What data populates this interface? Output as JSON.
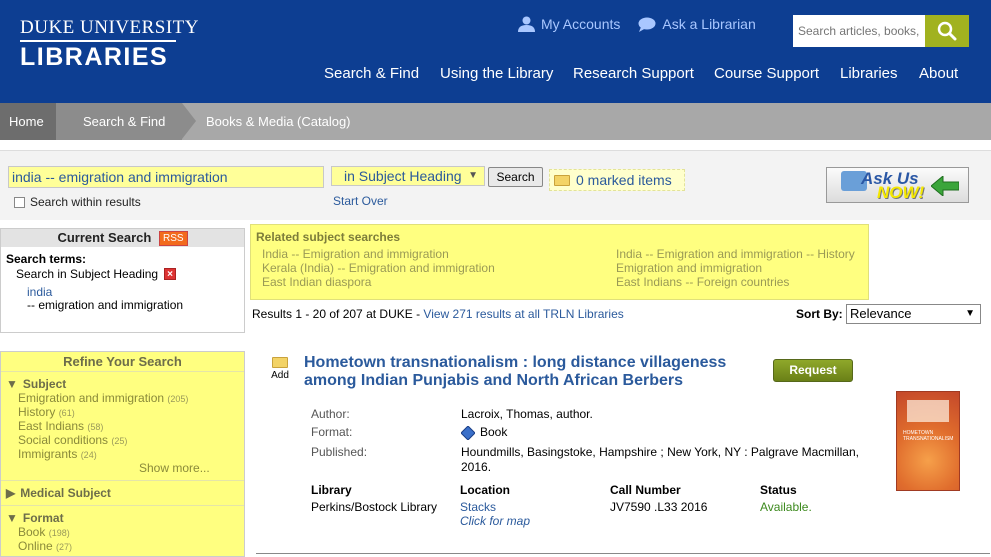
{
  "header": {
    "logo_line1": "DUKE UNIVERSITY",
    "logo_line2": "LIBRARIES",
    "my_accounts": "My Accounts",
    "ask_librarian": "Ask a Librarian",
    "search_placeholder": "Search articles, books,",
    "nav": [
      "Search & Find",
      "Using the Library",
      "Research Support",
      "Course Support",
      "Libraries",
      "About"
    ]
  },
  "breadcrumb": [
    "Home",
    "Search & Find",
    "Books & Media (Catalog)"
  ],
  "search": {
    "query": "india -- emigration and immigration",
    "scope": "in Subject Heading",
    "button": "Search",
    "marked": "0 marked items",
    "within": "Search within results",
    "start_over": "Start Over",
    "ask_us_1": "Ask Us",
    "ask_us_2": "NOW!"
  },
  "current_search": {
    "title": "Current Search",
    "rss": "RSS",
    "terms_label": "Search terms:",
    "heading": "Search in Subject Heading",
    "term1": "india",
    "term2": "--  emigration and immigration"
  },
  "refine": {
    "title": "Refine Your Search",
    "subject": "Subject",
    "subject_items": [
      {
        "label": "Emigration and immigration",
        "count": "(205)"
      },
      {
        "label": "History",
        "count": "(61)"
      },
      {
        "label": "East Indians",
        "count": "(58)"
      },
      {
        "label": "Social conditions",
        "count": "(25)"
      },
      {
        "label": "Immigrants",
        "count": "(24)"
      }
    ],
    "show_more": "Show more...",
    "medical_subject": "Medical Subject",
    "format": "Format",
    "format_items": [
      {
        "label": "Book",
        "count": "(198)"
      },
      {
        "label": "Online",
        "count": "(27)"
      }
    ]
  },
  "related": {
    "title": "Related subject searches",
    "links": [
      "India -- Emigration and immigration",
      "Kerala (India) -- Emigration and immigration",
      "East Indian diaspora",
      "India -- Emigration and immigration -- History",
      "Emigration and immigration",
      "East Indians -- Foreign countries"
    ]
  },
  "results": {
    "summary": "Results 1 - 20 of 207 at DUKE - ",
    "trln": "View 271 results at all TRLN Libraries",
    "sort_label": "Sort By:",
    "sort_value": "Relevance"
  },
  "item": {
    "add": "Add",
    "title": "Hometown transnationalism : long distance villageness among Indian Punjabis and North African Berbers",
    "request": "Request",
    "author_label": "Author:",
    "author": "Lacroix, Thomas, author.",
    "format_label": "Format:",
    "format": "Book",
    "published_label": "Published:",
    "published": "Houndmills, Basingstoke, Hampshire ; New York, NY : Palgrave Macmillan, 2016.",
    "cover_title": "HOMETOWN TRANSNATIONALISM",
    "holdings_headers": [
      "Library",
      "Location",
      "Call Number",
      "Status"
    ],
    "library": "Perkins/Bostock Library",
    "location": "Stacks",
    "map": "Click for map",
    "call_number": "JV7590 .L33 2016",
    "status": "Available."
  }
}
